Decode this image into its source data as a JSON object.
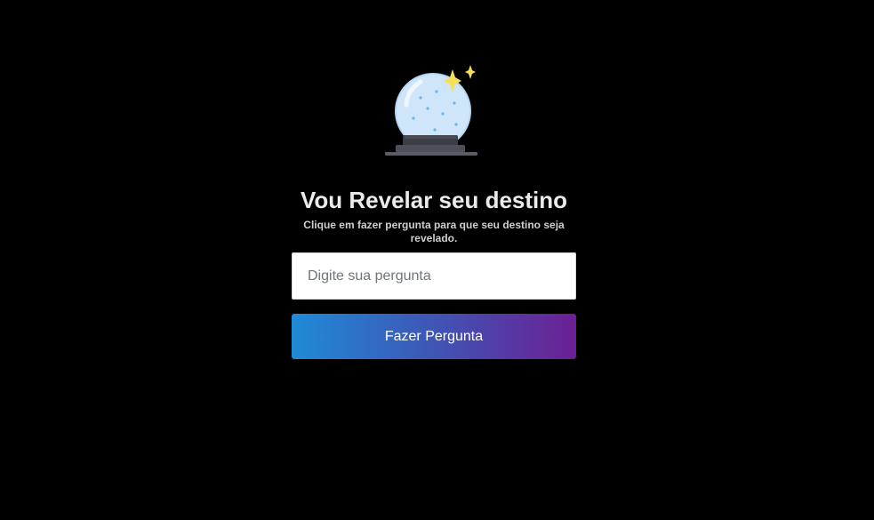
{
  "header": {
    "logo_icon": "crystal-ball-icon",
    "title": "Vou Revelar seu destino",
    "subtitle": "Clique em fazer pergunta para que seu destino seja revelado."
  },
  "form": {
    "question_placeholder": "Digite sua pergunta",
    "question_value": "",
    "submit_label": "Fazer Pergunta"
  },
  "colors": {
    "background": "#000000",
    "button_gradient_start": "#1f8bd6",
    "button_gradient_end": "#6c1f94",
    "sparkle": "#f7df5c",
    "crystal_ball": "#cfe6fa"
  }
}
